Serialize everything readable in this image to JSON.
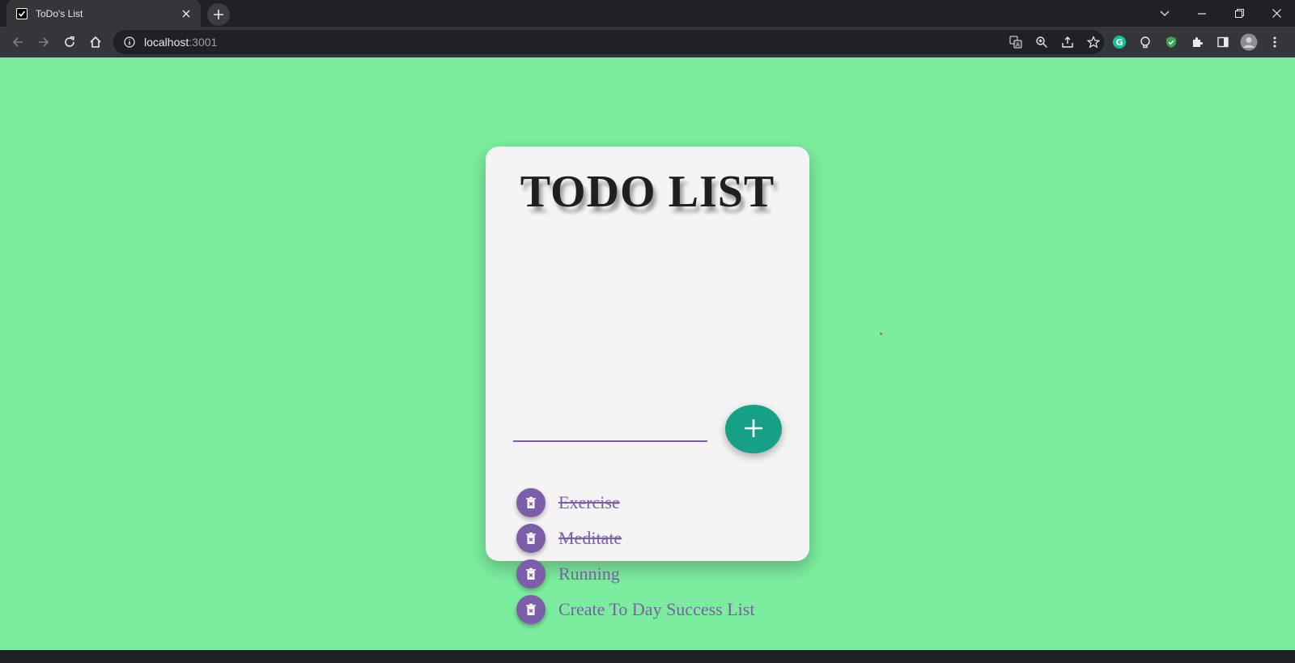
{
  "browser": {
    "tab_title": "ToDo's List",
    "url_host": "localhost",
    "url_port": ":3001"
  },
  "app": {
    "title": "TODO LIST",
    "input_value": "",
    "add_icon": "plus-icon",
    "delete_icon": "trash-icon",
    "items": [
      {
        "text": "Exercise",
        "completed": true
      },
      {
        "text": "Meditate",
        "completed": true
      },
      {
        "text": "Running",
        "completed": false
      },
      {
        "text": "Create To Day Success List",
        "completed": false
      }
    ]
  },
  "colors": {
    "page_background": "#7ced9e",
    "card_background": "#f4f4f4",
    "accent_purple": "#7b5ea7",
    "add_button_teal": "#16a085",
    "title_text": "#1f1f1f"
  }
}
